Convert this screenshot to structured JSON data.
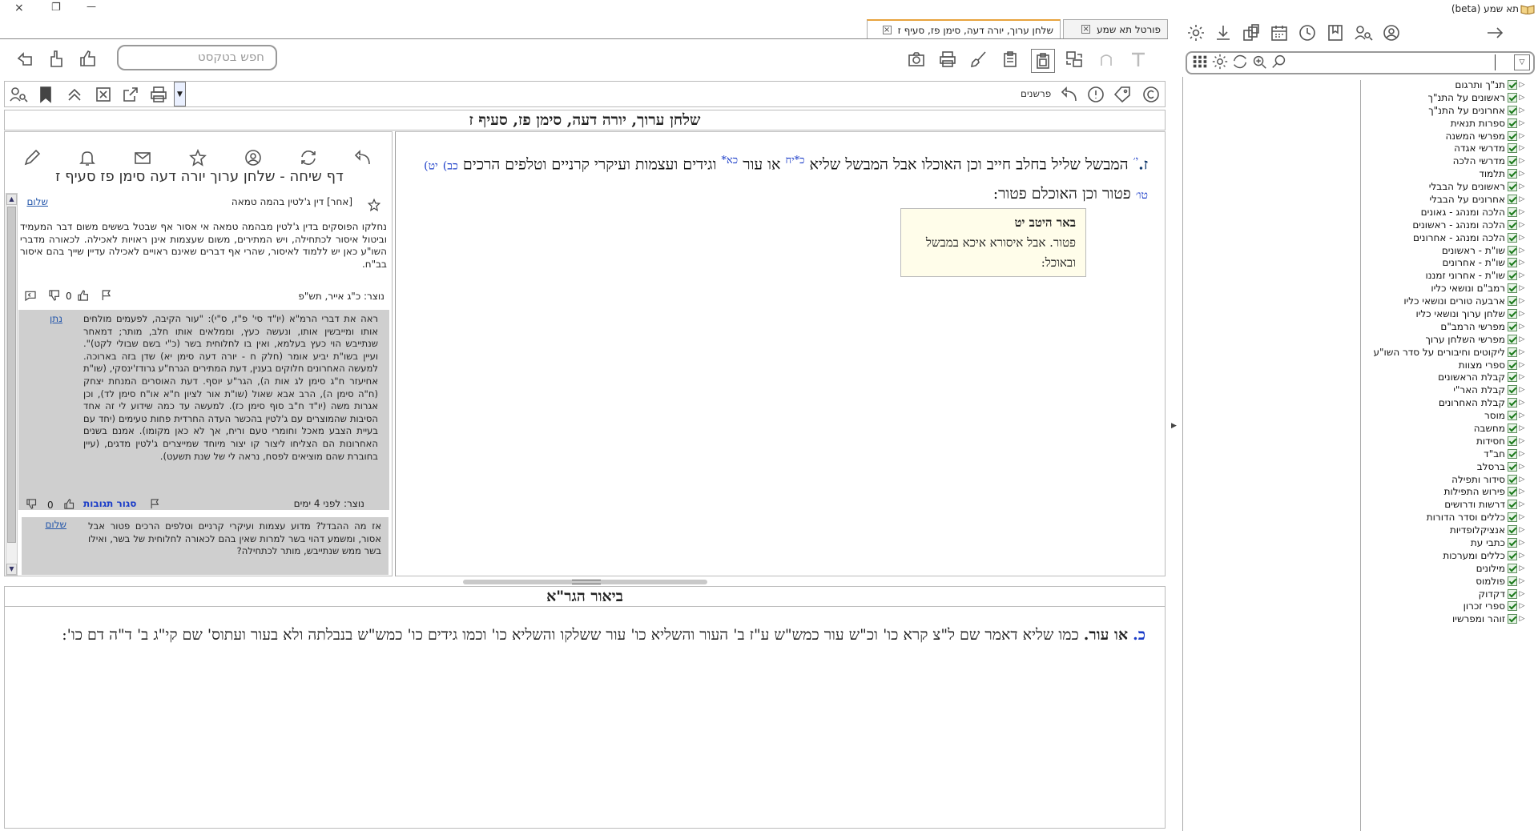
{
  "window": {
    "title": "תא שמע (beta)",
    "controls": [
      "×",
      "❐",
      "—"
    ]
  },
  "tabs": [
    {
      "label": "פורטל תא שמע",
      "active": false
    },
    {
      "label": "שלחן ערוך, יורה דעה, סימן פז, סעיף ז",
      "active": true
    }
  ],
  "toolbar": {
    "search_placeholder": "חפש בטקסט",
    "commentaries_label": "פרשנים"
  },
  "main": {
    "title": "שלחן ערוך,  יורה דעה, סימן פז, סעיף ז",
    "seif_letter": "ז.",
    "marker_yi": "י׳",
    "text_1": "המבשל שליל בחלב חייב וכן האוכלו אבל המבשל שליא",
    "ref_kaf": "כ*",
    "ref_yach": "יח",
    "text_2": "או עור",
    "ref_kaa": "כא*",
    "text_3": "וגידים ועצמות ועיקרי קרניים וטלפים הרכים",
    "ref_kab": "כב)",
    "ref_yav": "יט)",
    "ref_tav": "טו׳",
    "text_4": "פטור וכן האוכלם פטור:"
  },
  "popup": {
    "title": "באר היטב יט",
    "body": "פטור. אבל איסורא איכא במבשל ובאוכל:"
  },
  "discussion": {
    "title": "דף שיחה - שלחן ערוך יורה דעה סימן פז סעיף ז",
    "post1": {
      "header": "[אחר] דין ג'לטין בהמה טמאה",
      "author": "שלום",
      "body": "נחלקו הפוסקים בדין ג'לטין מבהמה טמאה אי אסור אף שבטל בששים משום דבר המעמיד וביטול איסור לכתחילה, ויש המתירים, משום שעצמות אינן ראויות לאכילה. לכאורה מדברי השו\"ע כאן יש ללמוד לאיסור, שהרי אף דברים שאינם ראויים לאכילה עדיין שייך בהם איסור בב\"ח.",
      "created": "נוצר: כ\"ג אייר, תש\"פ",
      "likes": "0"
    },
    "reply1": {
      "author": "נתן",
      "body": "ראה את דברי הרמ\"א (יו\"ד סי' פ\"ז, ס\"י): \"עור הקיבה, לפעמים מולחים אותו ומייבשין אותו, ונעשה כעץ, וממלאים אותו חלב, מותר; דמאחר שנתייבש הוי כעץ בעלמא, ואין בו לחלוחית בשר (כ\"י בשם שבולי לקט)\". ועיין בשו\"ת יביע אומר (חלק ח - יורה דעה סימן יא) שדן בזה בארוכה. למעשה האחרונים חלוקים בענין, דעת המתירים הגרח\"ע גרודז'ינסקי, (שו\"ת אחיעזר ח\"ג סימן לג אות ה), הגר\"ע יוסף. דעת האוסרים המנחת יצחק (ח\"ה סימן ה), הרב אבא שאול (שו\"ת אור לציון ח\"א או\"ח סימן לד), וכן אגרות משה (יו\"ד ח\"ב סוף סימן כז). למעשה עד כמה שידוע לי זה אחד הסיבות שהמוצרים עם ג'לטין בהכשר העדה החרדית פחות טעימים (יחד עם בעיית הצבע מאכל וחומרי טעם וריח, אך לא כאן מקומו). אמנם בשנים האחרונות הם הצליחו ליצור קו יצור מיוחד שמייצרים ג'לטין מדגים, (עיין בחוברת שהם מוציאים לפסח, נראה לי של שנת תשעט).",
      "created": "נוצר: לפני 4 ימים",
      "close_label": "סגור תגובות",
      "likes": "0"
    },
    "reply2": {
      "author": "שלום",
      "body": "אז מה ההבדל? מדוע עצמות ועיקרי קרניים וטלפים הרכים פטור אבל אסור, ומשמע דהוי בשר למרות שאין בהם לכאורה לחלוחית של בשר, ואילו בשר ממש שנתייבש, מותר לכתחילה?"
    }
  },
  "bottom": {
    "title": "ביאור הגר\"א",
    "label": "כ.",
    "head": "או עור.",
    "text": "כמו שליא דאמר שם ל\"צ קרא כו' וכ\"ש עור כמש\"ש ע\"ז ב' העור והשליא כו' עור ששלקו והשליא כו' וכמו גידים כו' כמש\"ש בנבלתה ולא בעור ועתוס' שם קי\"ג ב' ד\"ה דם כו':"
  },
  "tree": {
    "items": [
      "תנ\"ך ותרגום",
      "ראשונים על התנ\"ך",
      "אחרונים על התנ\"ך",
      "ספרות תנאית",
      "מפרשי המשנה",
      "מדרשי אגדה",
      "מדרשי הלכה",
      "תלמוד",
      "ראשונים על הבבלי",
      "אחרונים על הבבלי",
      "הלכה ומנהג - גאונים",
      "הלכה ומנהג - ראשונים",
      "הלכה ומנהג - אחרונים",
      "שו\"ת - ראשונים",
      "שו\"ת - אחרונים",
      "שו\"ת - אחרוני זמננו",
      "רמב\"ם ונושאי כליו",
      "ארבעה טורים ונושאי כליו",
      "שלחן ערוך ונושאי כליו",
      "מפרשי הרמב\"ם",
      "מפרשי השלחן ערוך",
      "ליקוטים וחיבורים על סדר השו\"ע",
      "ספרי מצוות",
      "קבלת הראשונים",
      "קבלת האר\"י",
      "קבלת האחרונים",
      "מוסר",
      "מחשבה",
      "חסידות",
      "חב\"ד",
      "ברסלב",
      "סידור ותפילה",
      "פירוש התפילות",
      "דרשות ודרושים",
      "כללים וסדר הדורות",
      "אנציקלופדיות",
      "כתבי עת",
      "כללים ומערכות",
      "מילונים",
      "פולמוס",
      "דקדוק",
      "ספרי זכרון",
      "זוהר ומפרשיו"
    ]
  },
  "colors": {
    "accent_tab": "#e8a33d",
    "link_blue": "#1a3cc8",
    "reply_bg": "#cfcfcf",
    "popup_bg": "#fffdea"
  }
}
